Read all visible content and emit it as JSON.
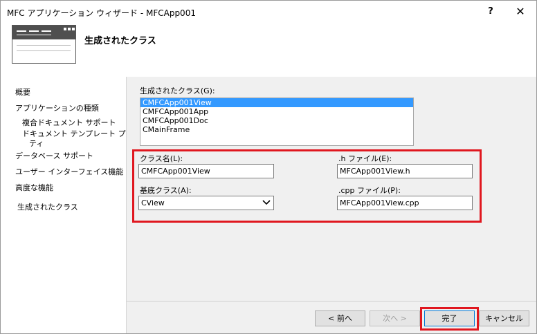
{
  "window": {
    "title": "MFC アプリケーション ウィザード - MFCApp001",
    "help_label": "?",
    "close_label": "✕"
  },
  "header": {
    "title": "生成されたクラス",
    "icon": "wizard-window-icon"
  },
  "nav": {
    "items": [
      {
        "label": "概要"
      },
      {
        "label": "アプリケーションの種類"
      },
      {
        "label": "複合ドキュメント サポート"
      },
      {
        "label": "ドキュメント テンプレート プロパ"
      },
      {
        "label": "ティ"
      },
      {
        "label": "データベース サポート"
      },
      {
        "label": "ユーザー インターフェイス機能"
      },
      {
        "label": "高度な機能"
      },
      {
        "label": "生成されたクラス"
      }
    ]
  },
  "classes": {
    "label": "生成されたクラス(G):",
    "list": [
      "CMFCApp001View",
      "CMFCApp001App",
      "CMFCApp001Doc",
      "CMainFrame"
    ],
    "selected_index": 0
  },
  "fields": {
    "class_name_label": "クラス名(L):",
    "class_name_value": "CMFCApp001View",
    "h_file_label": ".h ファイル(E):",
    "h_file_value": "MFCApp001View.h",
    "base_class_label": "基底クラス(A):",
    "base_class_value": "CView",
    "cpp_file_label": ".cpp ファイル(P):",
    "cpp_file_value": "MFCApp001View.cpp"
  },
  "footer": {
    "back_label": "< 前へ",
    "next_label": "次へ >",
    "finish_label": "完了",
    "cancel_label": "キャンセル"
  },
  "colors": {
    "highlight": "#e0171f",
    "selection": "#3399ff"
  }
}
